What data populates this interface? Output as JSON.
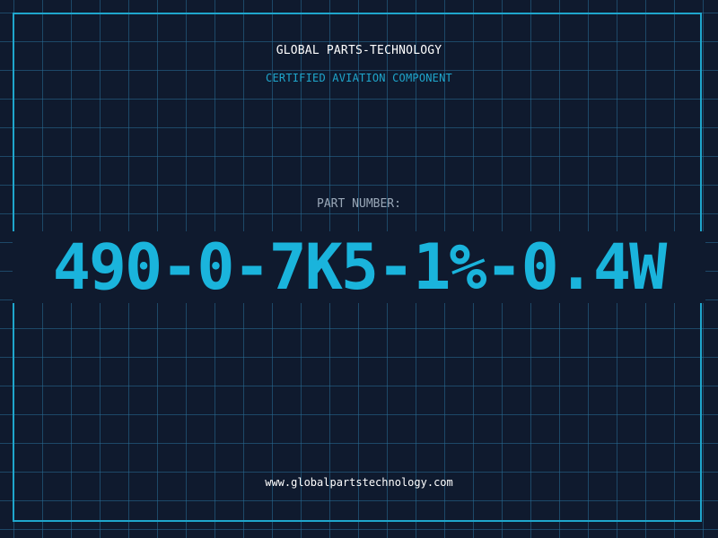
{
  "header": {
    "company": "GLOBAL PARTS-TECHNOLOGY",
    "subtitle": "CERTIFIED AVIATION COMPONENT"
  },
  "part": {
    "label": "PART NUMBER:",
    "number": "490-0-7K5-1%-0.4W"
  },
  "footer": {
    "url": "www.globalpartstechnology.com"
  },
  "colors": {
    "background": "#0f1a2e",
    "grid": "#286e96",
    "accent": "#1fa6cc",
    "part_number": "#1ab4dc",
    "label": "#9aa8b8",
    "text": "#ffffff"
  }
}
